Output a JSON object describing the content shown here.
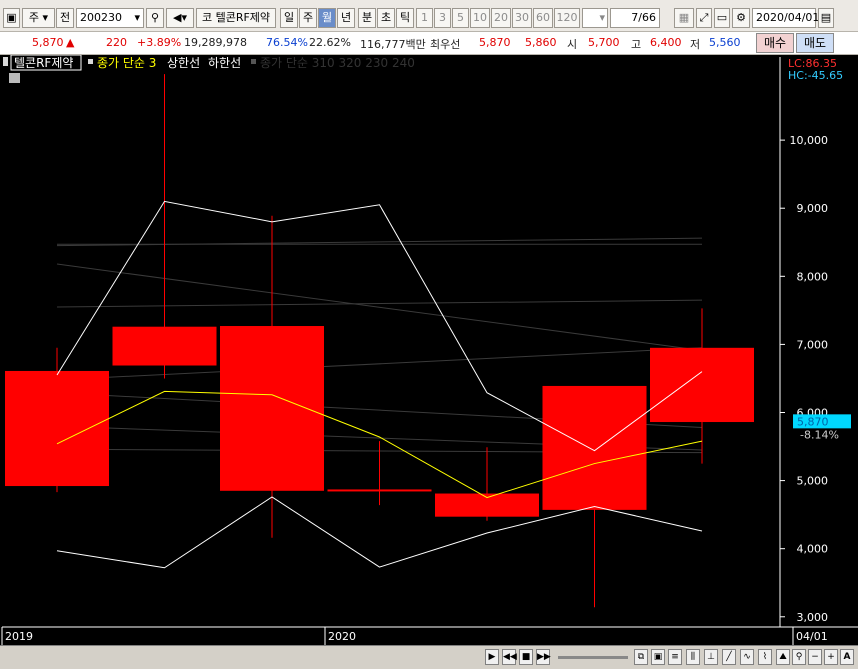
{
  "toolbar": {
    "type_label": "주",
    "prev_label": "전",
    "code_value": "200230",
    "market_label": "코",
    "stock_name": "텔콘RF제약",
    "period_day": "일",
    "period_week": "주",
    "period_month": "월",
    "period_year": "년",
    "period_minute": "분",
    "period_second": "초",
    "period_tick": "틱",
    "intervals": [
      "1",
      "3",
      "5",
      "10",
      "20",
      "30",
      "60",
      "120"
    ],
    "page_counter": "7/66",
    "date_value": "2020/04/01"
  },
  "quote": {
    "price": "5,870",
    "change": "220",
    "change_pct": "+3.89%",
    "volume": "19,289,978",
    "vol_ratio": "76.54%",
    "turnover": "22.62%",
    "amount": "116,777백만",
    "best_label": "최우선",
    "best_ask": "5,870",
    "best_bid": "5,860",
    "open_label": "시",
    "open": "5,700",
    "high_label": "고",
    "high": "6,400",
    "low_label": "저",
    "low": "5,560",
    "buy_label": "매수",
    "sell_label": "매도"
  },
  "legend": {
    "name": "텔콘RF제약",
    "ma_label": "종가 단순 3",
    "upper_label": "상한선",
    "lower_label": "하한선",
    "ma2_label": "종가 단순 310 320 230 240",
    "lc_label": "LC:86.35",
    "hc_label": "HC:-45.65",
    "current_price_tag": "5,870",
    "current_pct_tag": "-8.14%"
  },
  "colors": {
    "up": "#ff0000",
    "down": "#00d8ff",
    "ma": "#ffff00",
    "band": "#ffffff"
  },
  "chart_data": {
    "type": "candlestick",
    "title": "",
    "x": [
      "2019-10",
      "2019-11",
      "2019-12",
      "2020-01",
      "2020-02",
      "2020-03",
      "2020-04"
    ],
    "x_tick_labels": [
      "2019",
      "2020",
      "04/01"
    ],
    "open": [
      4920,
      6690,
      4850,
      4850,
      4470,
      4570,
      5860
    ],
    "high": [
      6950,
      10970,
      8890,
      5580,
      5490,
      4610,
      7530
    ],
    "low": [
      4830,
      6500,
      4160,
      4640,
      4410,
      3140,
      5250
    ],
    "close": [
      6610,
      7260,
      7270,
      4870,
      4810,
      6390,
      6950
    ],
    "series": [
      {
        "name": "종가 단순 3",
        "values": [
          5540,
          6310,
          6260,
          5640,
          4750,
          5250,
          5580
        ]
      },
      {
        "name": "상한선",
        "values": [
          6550,
          9100,
          8800,
          9050,
          6290,
          5440,
          6600
        ]
      },
      {
        "name": "하한선",
        "values": [
          3970,
          3720,
          4760,
          3730,
          4230,
          4620,
          4260
        ]
      }
    ],
    "faint_lines": [
      [
        8470,
        8470
      ],
      [
        8450,
        8560
      ],
      [
        8180,
        6910
      ],
      [
        7550,
        7650
      ],
      [
        6480,
        6950
      ],
      [
        6290,
        5780
      ],
      [
        5800,
        5450
      ],
      [
        5460,
        5410
      ]
    ],
    "ylim": [
      2850,
      11250
    ],
    "yticks": [
      3000,
      4000,
      5000,
      6000,
      7000,
      8000,
      9000,
      10000
    ],
    "ytick_labels": [
      "3,000",
      "4,000",
      "5,000",
      "6,000",
      "7,000",
      "8,000",
      "9,000",
      "10,000"
    ],
    "current_price": 5870,
    "grid": false
  }
}
